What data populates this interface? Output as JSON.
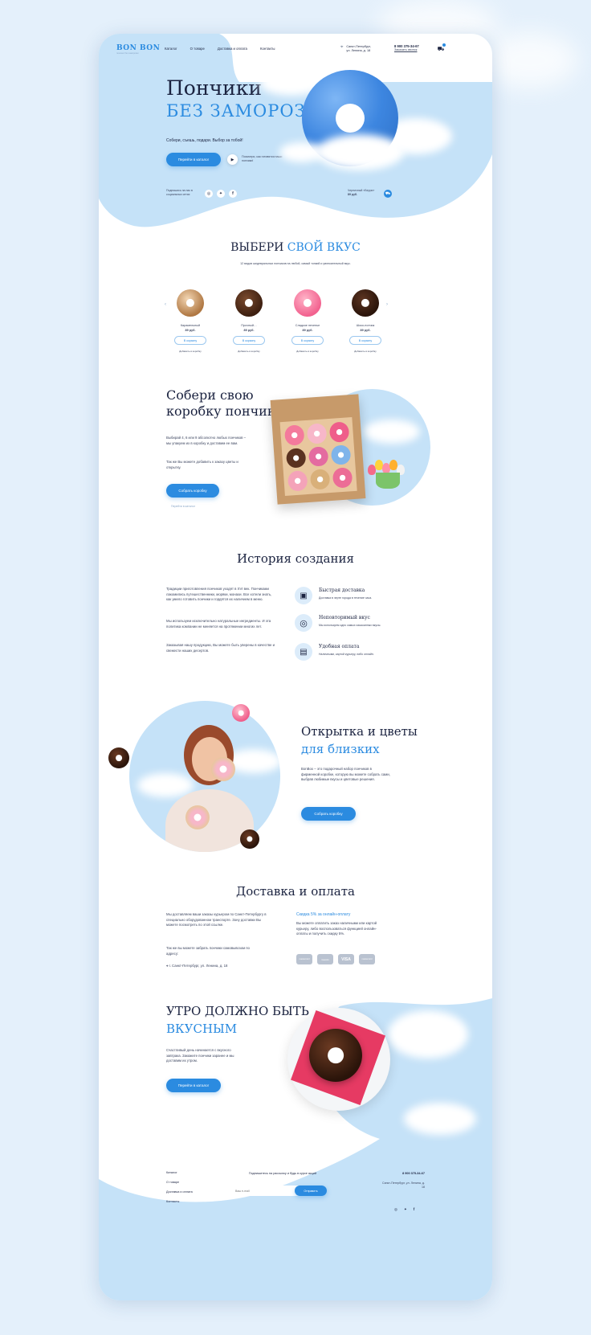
{
  "header": {
    "logo": "BON BON",
    "logo_sub": "пончики без заморозки",
    "nav": [
      "Каталог",
      "О товаре",
      "Доставка и оплата",
      "Контакты"
    ],
    "address": "Санкт-Петербург, ул. Ленина, д. 18",
    "phone": "8 900 375-34-67",
    "callback": "Заказать звонок"
  },
  "hero": {
    "title_line1": "Пончики",
    "title_line2": "БЕЗ ЗАМОРОЗКИ",
    "subtitle": "Собери, съешь, подари. Выбор за тобой!",
    "cta": "Перейти в каталог",
    "video_text": "Посмотри, как готовятся наши пончики!",
    "social_text": "Подпишись на нас в социальных сетях",
    "product_name": "Черничный «Берри»",
    "product_price": "89 руб."
  },
  "flavors": {
    "title_a": "ВЫБЕРИ",
    "title_b": "СВОЙ ВКУС",
    "subtitle": "12 видов шедевральных пончиков на любой, самый тонкий и увлекательный вкус.",
    "items": [
      {
        "name": "Карамельный",
        "price": "89 руб.",
        "btn": "В корзину",
        "more": "Добавить в коробку"
      },
      {
        "name": "Прочный…",
        "price": "89 руб.",
        "btn": "В корзину",
        "more": "Добавить в коробку"
      },
      {
        "name": "Сладкое печенье",
        "price": "89 руб.",
        "btn": "В корзину",
        "more": "Добавить в коробку"
      },
      {
        "name": "Шоко-пончик",
        "price": "89 руб.",
        "btn": "В корзину",
        "more": "Добавить в коробку"
      }
    ]
  },
  "box": {
    "title_line1": "Собери свою",
    "title_line2": "коробку пончиков",
    "text1": "Выбирай 4, 6 или 9 абсолютно любых пончиков – мы упакуем их в коробку и доставим ее вам.",
    "text2": "Так же Вы можете добавить к заказу цветы и открытку.",
    "cta": "Собрать коробку",
    "link": "Перейти в каталог"
  },
  "history": {
    "title": "История создания",
    "p1": "Традиции приготовления пончиков уходят в XVI век. Пончиками лакомились путешественники, моряки, монахи. Все хотели знать, как умело готовить пончики и гордятся их наличием в меню.",
    "p2": "Мы используем исключительно натуральные ингредиенты. И эта политика компании не меняется на протяжении многих лет.",
    "p3": "Заказывая нашу продукцию, Вы можете быть уверены в качестве и свежести наших десертов.",
    "features": [
      {
        "title": "Быстрая доставка",
        "text": "Доставка в черте города в течение часа.",
        "icon": "delivery-box-icon"
      },
      {
        "title": "Неповторимый вкус",
        "text": "Мы используем одно самых изысканных вкусы.",
        "icon": "donut-icon"
      },
      {
        "title": "Удобная оплата",
        "text": "Наличными, картой курьеру, либо онлайн.",
        "icon": "payment-card-icon"
      }
    ]
  },
  "gift": {
    "title_line1": "Открытка и цветы",
    "title_line2": "для близких",
    "text": "BonBox – это подарочный набор пончиков в фирменной коробке, которую вы можете собрать сами, выбрав любимые вкусы и цветовые решения.",
    "cta": "Собрать коробку"
  },
  "delivery": {
    "title": "Доставка и оплата",
    "p1": "Мы доставляем ваши заказы курьером по Санкт-Петербургу в специально оборудованном транспорте. Зону доставки Вы можете посмотреть по этой ссылке.",
    "p2": "Так же вы можете забрать пончики самовывозом по адресу:",
    "address": "г. Санкт-Петербург, ул. Ленина, д. 18",
    "discount_title": "Скидка 5% за онлайн-оплату",
    "discount_text": "Вы можете оплатить заказ наличными или картой курьеру, либо воспользоваться функцией онлайн-оплаты и получить скидку 5%.",
    "payments": [
      "mastercard",
      "maestro",
      "VISA",
      "mastercard"
    ]
  },
  "morning": {
    "title_line1": "Утро должно быть",
    "title_line2": "вкусным",
    "text": "Счастливый день начинается с вкусного завтрака. Закажите пончики заранее и мы доставим их утром.",
    "cta": "Перейти в каталог"
  },
  "footer": {
    "links": [
      "Каталог",
      "О товаре",
      "Доставка и оплата",
      "Контакты"
    ],
    "subscribe_title": "Подпишитесь на рассылку и будь в курсе акций",
    "email_placeholder": "Ваш e-mail",
    "subscribe_btn": "Отправить",
    "phone": "8 900 375-34-67",
    "address": "Санкт-Петербург, ул. Ленина, д. 18"
  },
  "colors": {
    "accent": "#2b8be0",
    "sky": "#c5e2f8",
    "dark": "#1b2340"
  }
}
